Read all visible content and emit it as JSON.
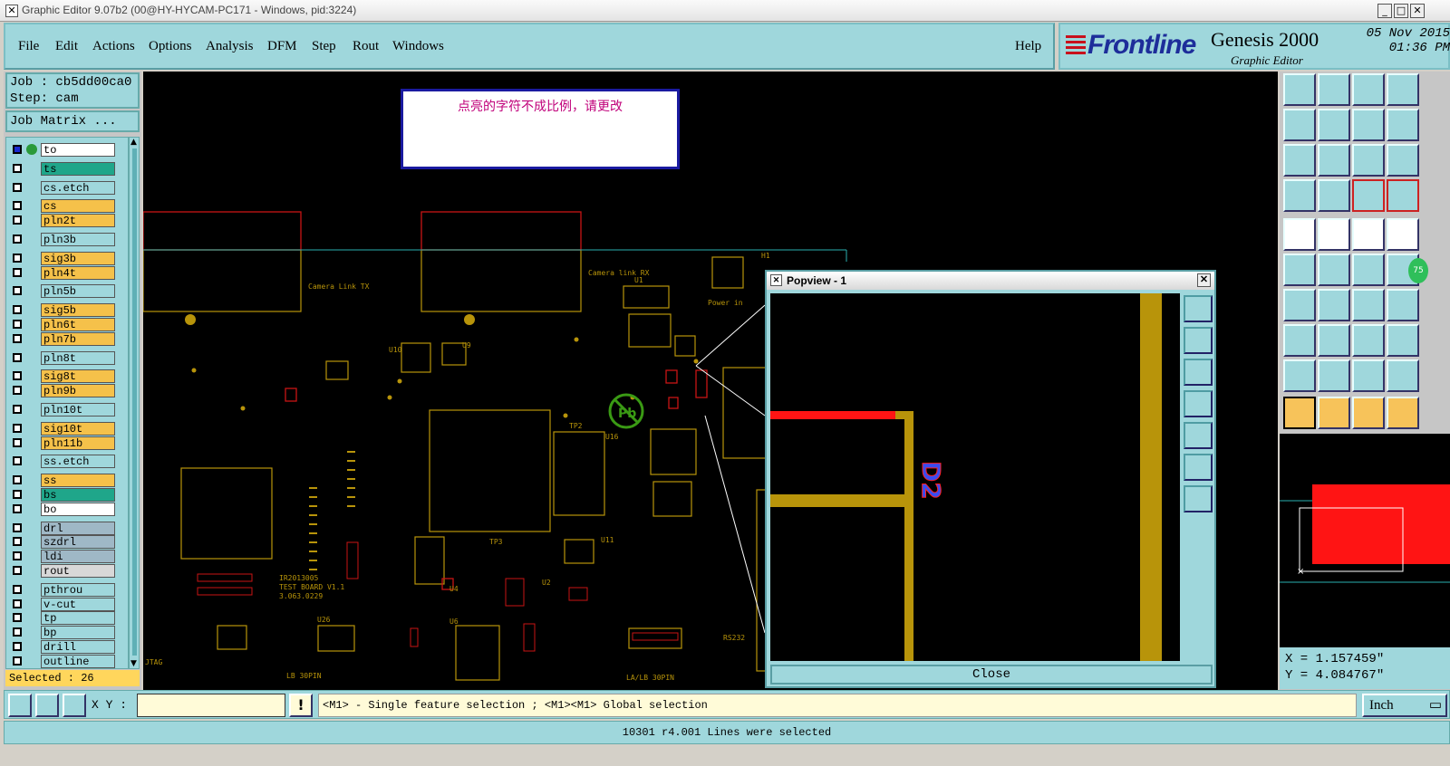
{
  "window": {
    "title": "Graphic Editor 9.07b2 (00@HY-HYCAM-PC171 - Windows, pid:3224)"
  },
  "menu": {
    "items": [
      "File",
      "Edit",
      "Actions",
      "Options",
      "Analysis",
      "DFM",
      "Step",
      "Rout",
      "Windows"
    ],
    "help": "Help"
  },
  "logo": {
    "brand": "Frontline",
    "product": "Genesis 2000",
    "subtitle": "Graphic Editor",
    "date": "05 Nov 2015",
    "time": "01:36 PM"
  },
  "job": {
    "job_label": "Job : cb5dd00ca0",
    "step_label": "Step: cam",
    "matrix_button": "Job Matrix ..."
  },
  "layers": [
    {
      "name": "to",
      "bg": "#ffffff"
    },
    {
      "name": "ts",
      "bg": "#1fa68a"
    },
    {
      "name": "cs.etch",
      "bg": "#9fd7dc"
    },
    {
      "name": "cs",
      "bg": "#f5c14a"
    },
    {
      "name": "pln2t",
      "bg": "#f5c14a"
    },
    {
      "name": "pln3b",
      "bg": "#9fd7dc"
    },
    {
      "name": "sig3b",
      "bg": "#f5c14a"
    },
    {
      "name": "pln4t",
      "bg": "#f5c14a"
    },
    {
      "name": "pln5b",
      "bg": "#9fd7dc"
    },
    {
      "name": "sig5b",
      "bg": "#f5c14a"
    },
    {
      "name": "pln6t",
      "bg": "#f5c14a"
    },
    {
      "name": "pln7b",
      "bg": "#f5c14a"
    },
    {
      "name": "pln8t",
      "bg": "#9fd7dc"
    },
    {
      "name": "sig8t",
      "bg": "#f5c14a"
    },
    {
      "name": "pln9b",
      "bg": "#f5c14a"
    },
    {
      "name": "pln10t",
      "bg": "#9fd7dc"
    },
    {
      "name": "sig10t",
      "bg": "#f5c14a"
    },
    {
      "name": "pln11b",
      "bg": "#f5c14a"
    },
    {
      "name": "ss.etch",
      "bg": "#9fd7dc"
    },
    {
      "name": "ss",
      "bg": "#f5c14a"
    },
    {
      "name": "bs",
      "bg": "#1fa68a"
    },
    {
      "name": "bo",
      "bg": "#ffffff"
    },
    {
      "name": "drl",
      "bg": "#9fb8c6"
    },
    {
      "name": "szdrl",
      "bg": "#9fb8c6"
    },
    {
      "name": "ldi",
      "bg": "#9fb8c6"
    },
    {
      "name": "rout",
      "bg": "#d8d8d8"
    },
    {
      "name": "pthrou",
      "bg": "#9fd7dc"
    },
    {
      "name": "v-cut",
      "bg": "#9fd7dc"
    },
    {
      "name": "tp",
      "bg": "#9fd7dc"
    },
    {
      "name": "bp",
      "bg": "#9fd7dc"
    },
    {
      "name": "drill",
      "bg": "#9fd7dc"
    },
    {
      "name": "outline",
      "bg": "#9fd7dc"
    }
  ],
  "selected": "Selected : 26",
  "canvas": {
    "message": "点亮的字符不成比例，请更改",
    "labels": [
      "Camera Link TX",
      "Camera link RX",
      "Power in",
      "IR2013005",
      "TEST BOARD V1.1",
      "3.063.0229",
      "LB 30PIN",
      "LA/LB 30PIN",
      "RS232",
      "JTAG",
      "H1",
      "U1",
      "U2",
      "U4",
      "U6",
      "U9",
      "U10",
      "U11",
      "U16",
      "U26",
      "TP2",
      "TP3"
    ]
  },
  "popview": {
    "title": "Popview - 1",
    "close_label": "Close",
    "feature_text": "D2"
  },
  "coords": {
    "x": "X =  1.157459\"",
    "y": "Y =  4.084767\""
  },
  "bottom": {
    "xy_label": "X Y :",
    "hint": "<M1> - Single feature selection ; <M1><M1> Global selection",
    "unit": "Inch"
  },
  "status": "10301 r4.001 Lines were selected",
  "colors": {
    "panel": "#9fd7dc",
    "highlight": "#f5c14a",
    "board": "#b8940a",
    "select": "#ff0000"
  }
}
